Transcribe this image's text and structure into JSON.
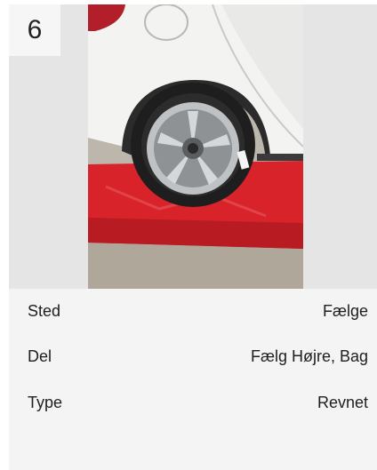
{
  "item": {
    "number": "6",
    "photo_description_icon": "car-wheel-photo",
    "fields": [
      {
        "label": "Sted",
        "value": "Fælge"
      },
      {
        "label": "Del",
        "value": "Fælg Højre, Bag"
      },
      {
        "label": "Type",
        "value": "Revnet"
      }
    ]
  },
  "colors": {
    "card_background": "#f4f4f4",
    "photo_background": "#e5e5e5",
    "ramp_red": "#d9232b"
  }
}
